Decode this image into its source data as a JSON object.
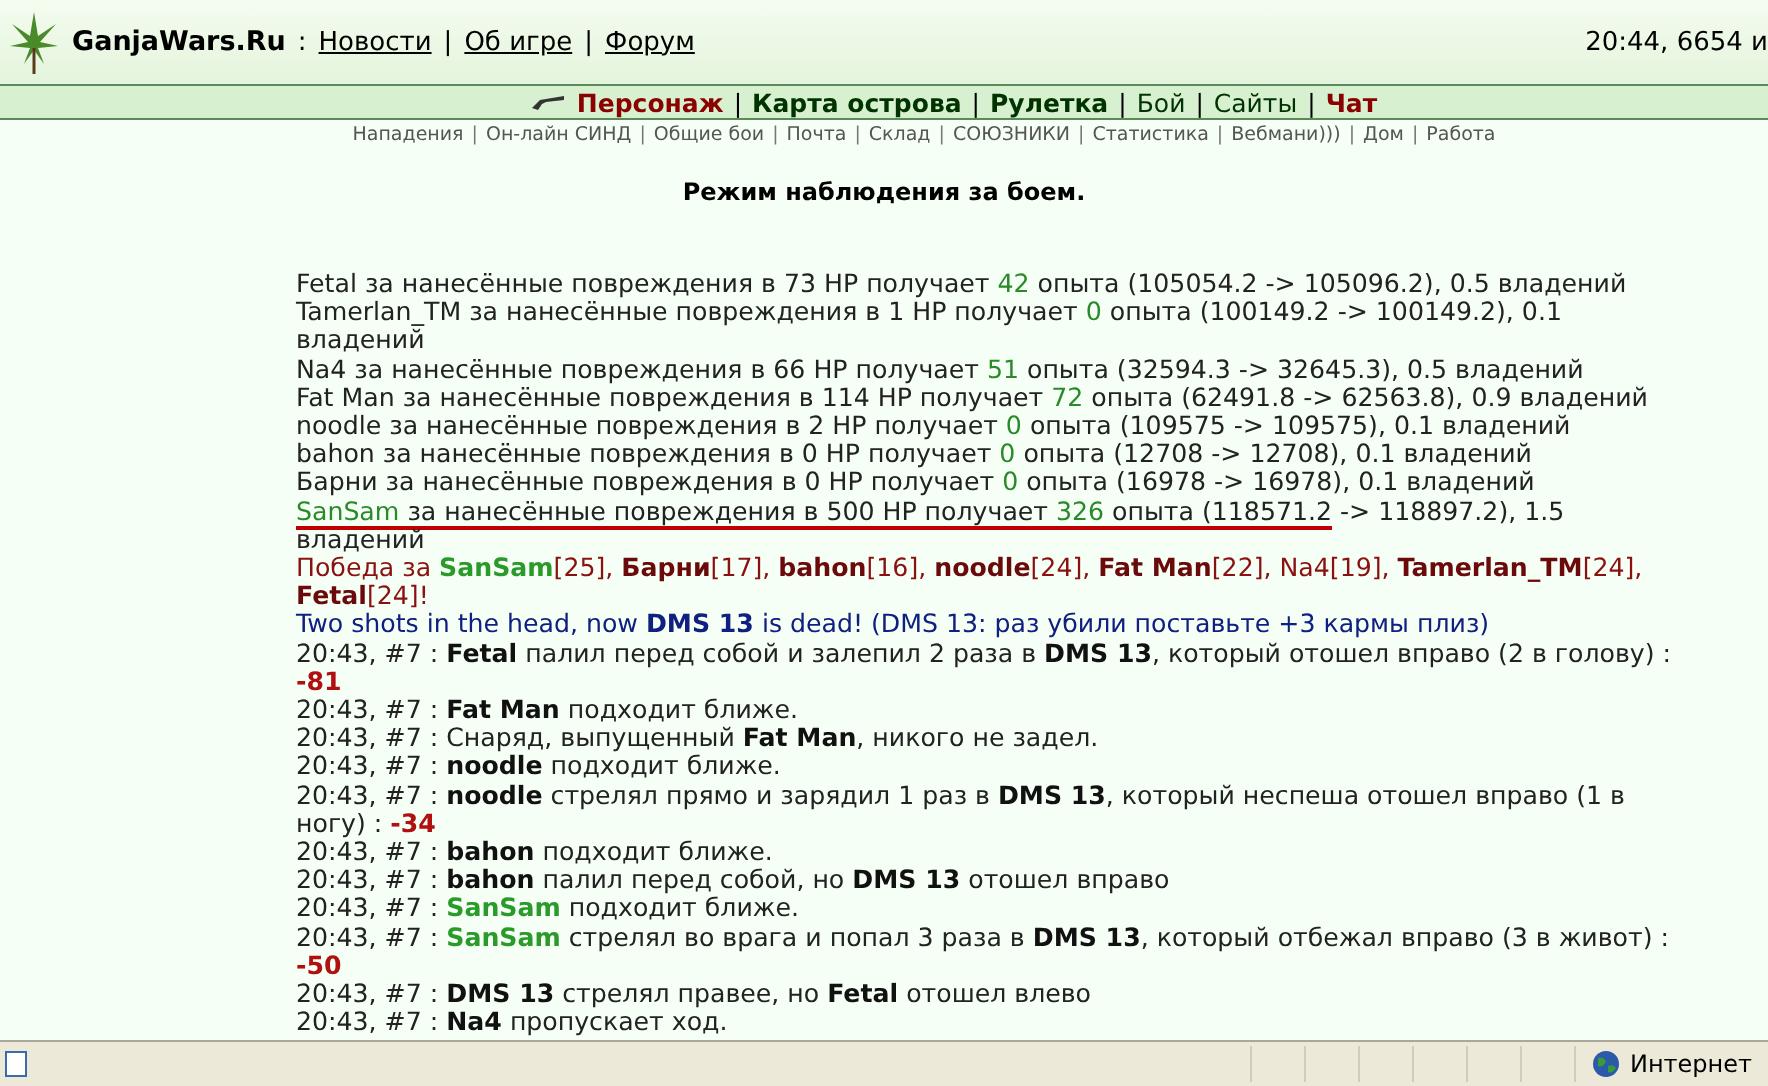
{
  "header": {
    "site": "GanjaWars.Ru",
    "separator": ":",
    "links": [
      "Новости",
      "Об игре",
      "Форум"
    ],
    "link_separator": "|",
    "status": "20:44, 6654 и"
  },
  "nav": [
    {
      "label": "Персонаж",
      "kind": "accent"
    },
    {
      "label": "Карта острова",
      "kind": "bold"
    },
    {
      "label": "Рулетка",
      "kind": "bold"
    },
    {
      "label": "Бой",
      "kind": "plain"
    },
    {
      "label": "Сайты",
      "kind": "plain"
    },
    {
      "label": "Чат",
      "kind": "accent"
    }
  ],
  "nav_separator": "|",
  "subnav": [
    "Нападения",
    "Он-лайн СИНД",
    "Общие бои",
    "Почта",
    "Склад",
    "СОЮЗНИКИ",
    "Статистика",
    "Вебмани)))",
    "Дом",
    "Работа"
  ],
  "subnav_separator": "|",
  "title": "Режим наблюдения за боем.",
  "log": [
    [
      {
        "text": "Fetal за нанесённые повреждения в 73 HP получает ",
        "kind": "plain"
      },
      {
        "text": "42",
        "kind": "num"
      },
      {
        "text": " опыта (105054.2 -> 105096.2), 0.5 владений",
        "kind": "plain"
      }
    ],
    [
      {
        "text": "Tamerlan_TM за нанесённые повреждения в 1 HP получает ",
        "kind": "plain"
      },
      {
        "text": "0",
        "kind": "num"
      },
      {
        "text": " опыта (100149.2 -> 100149.2), 0.1 владений",
        "kind": "plain"
      }
    ],
    [
      {
        "text": "Na4 за нанесённые повреждения в 66 HP получает ",
        "kind": "plain"
      },
      {
        "text": "51",
        "kind": "num"
      },
      {
        "text": " опыта (32594.3 -> 32645.3), 0.5 владений",
        "kind": "plain"
      }
    ],
    [
      {
        "text": "Fat Man за нанесённые повреждения в 114 HP получает ",
        "kind": "plain"
      },
      {
        "text": "72",
        "kind": "num"
      },
      {
        "text": " опыта (62491.8 -> 62563.8), 0.9 владений",
        "kind": "plain"
      }
    ],
    [
      {
        "text": "noodle за нанесённые повреждения в 2 HP получает ",
        "kind": "plain"
      },
      {
        "text": "0",
        "kind": "num"
      },
      {
        "text": " опыта (109575 -> 109575), 0.1 владений",
        "kind": "plain"
      }
    ],
    [
      {
        "text": "bahon за нанесённые повреждения в 0 HP получает ",
        "kind": "plain"
      },
      {
        "text": "0",
        "kind": "num"
      },
      {
        "text": " опыта (12708 -> 12708), 0.1 владений",
        "kind": "plain"
      }
    ],
    [
      {
        "text": "Барни за нанесённые повреждения в 0 HP получает ",
        "kind": "plain"
      },
      {
        "text": "0",
        "kind": "num"
      },
      {
        "text": " опыта (16978 -> 16978), 0.1 владений",
        "kind": "plain"
      }
    ],
    [
      {
        "text": "SanSam",
        "kind": "num",
        "underline": true
      },
      {
        "text": " за нанесённые повреждения в 500 HP получает ",
        "kind": "plain",
        "underline": true
      },
      {
        "text": "326",
        "kind": "num",
        "underline": true
      },
      {
        "text": " опыта (118571.2",
        "kind": "plain",
        "underline": true
      },
      {
        "text": " -> 118897.2), 1.5 владений",
        "kind": "plain",
        "underline": false
      }
    ],
    [
      {
        "text": "Победа за ",
        "kind": "win"
      },
      {
        "text": "SanSam",
        "kind": "ally"
      },
      {
        "text": "[25], ",
        "kind": "win"
      },
      {
        "text": "Барни",
        "kind": "enemy"
      },
      {
        "text": "[17], ",
        "kind": "win"
      },
      {
        "text": "bahon",
        "kind": "enemy"
      },
      {
        "text": "[16], ",
        "kind": "win"
      },
      {
        "text": "noodle",
        "kind": "enemy"
      },
      {
        "text": "[24], ",
        "kind": "win"
      },
      {
        "text": "Fat Man",
        "kind": "enemy"
      },
      {
        "text": "[22], ",
        "kind": "win"
      },
      {
        "text": "Na4",
        "kind": "win"
      },
      {
        "text": "[19], ",
        "kind": "win"
      },
      {
        "text": "Tamerlan_TM",
        "kind": "enemy"
      },
      {
        "text": "[24], ",
        "kind": "win"
      },
      {
        "text": "Fetal",
        "kind": "enemy"
      },
      {
        "text": "[24]!",
        "kind": "win"
      }
    ],
    [
      {
        "text": "Two shots in the head, now ",
        "kind": "blue"
      },
      {
        "text": "DMS 13",
        "kind": "bluebold"
      },
      {
        "text": " is dead! (DMS 13: раз убили поставьте +3 кармы плиз)",
        "kind": "blue"
      }
    ],
    [
      {
        "text": "20:43, #7 : ",
        "kind": "plain"
      },
      {
        "text": "Fetal",
        "kind": "name"
      },
      {
        "text": " палил перед собой и залепил 2 раза в ",
        "kind": "plain"
      },
      {
        "text": "DMS 13",
        "kind": "name"
      },
      {
        "text": ", который отошел вправо (2 в голову) : ",
        "kind": "plain"
      },
      {
        "text": "-81",
        "kind": "damage"
      }
    ],
    [
      {
        "text": "20:43, #7 : ",
        "kind": "plain"
      },
      {
        "text": "Fat Man",
        "kind": "name"
      },
      {
        "text": " подходит ближе.",
        "kind": "plain"
      }
    ],
    [
      {
        "text": "20:43, #7 : Снаряд, выпущенный ",
        "kind": "plain"
      },
      {
        "text": "Fat Man",
        "kind": "name"
      },
      {
        "text": ", никого не задел.",
        "kind": "plain"
      }
    ],
    [
      {
        "text": "20:43, #7 : ",
        "kind": "plain"
      },
      {
        "text": "noodle",
        "kind": "name"
      },
      {
        "text": " подходит ближе.",
        "kind": "plain"
      }
    ],
    [
      {
        "text": "20:43, #7 : ",
        "kind": "plain"
      },
      {
        "text": "noodle",
        "kind": "name"
      },
      {
        "text": " стрелял прямо и зарядил 1 раз в ",
        "kind": "plain"
      },
      {
        "text": "DMS 13",
        "kind": "name"
      },
      {
        "text": ", который неспеша отошел вправо (1 в ногу) : ",
        "kind": "plain"
      },
      {
        "text": "-34",
        "kind": "damage"
      }
    ],
    [
      {
        "text": "20:43, #7 : ",
        "kind": "plain"
      },
      {
        "text": "bahon",
        "kind": "name"
      },
      {
        "text": " подходит ближе.",
        "kind": "plain"
      }
    ],
    [
      {
        "text": "20:43, #7 : ",
        "kind": "plain"
      },
      {
        "text": "bahon",
        "kind": "name"
      },
      {
        "text": " палил перед собой, но ",
        "kind": "plain"
      },
      {
        "text": "DMS 13",
        "kind": "name"
      },
      {
        "text": " отошел вправо",
        "kind": "plain"
      }
    ],
    [
      {
        "text": "20:43, #7 : ",
        "kind": "plain"
      },
      {
        "text": "SanSam",
        "kind": "ally"
      },
      {
        "text": " подходит ближе.",
        "kind": "plain"
      }
    ],
    [
      {
        "text": "20:43, #7 : ",
        "kind": "plain"
      },
      {
        "text": "SanSam",
        "kind": "ally"
      },
      {
        "text": " стрелял во врага и попал 3 раза в ",
        "kind": "plain"
      },
      {
        "text": "DMS 13",
        "kind": "name"
      },
      {
        "text": ", который отбежал вправо (3 в живот) : ",
        "kind": "plain"
      },
      {
        "text": "-50",
        "kind": "damage"
      }
    ],
    [
      {
        "text": "20:43, #7 : ",
        "kind": "plain"
      },
      {
        "text": "DMS 13",
        "kind": "name"
      },
      {
        "text": " стрелял правее, но ",
        "kind": "plain"
      },
      {
        "text": "Fetal",
        "kind": "name"
      },
      {
        "text": " отошел влево",
        "kind": "plain"
      }
    ],
    [
      {
        "text": "20:43, #7 : ",
        "kind": "plain"
      },
      {
        "text": "Na4",
        "kind": "name"
      },
      {
        "text": " пропускает ход.",
        "kind": "plain"
      }
    ]
  ],
  "status_bar": {
    "zone": "Интернет"
  }
}
